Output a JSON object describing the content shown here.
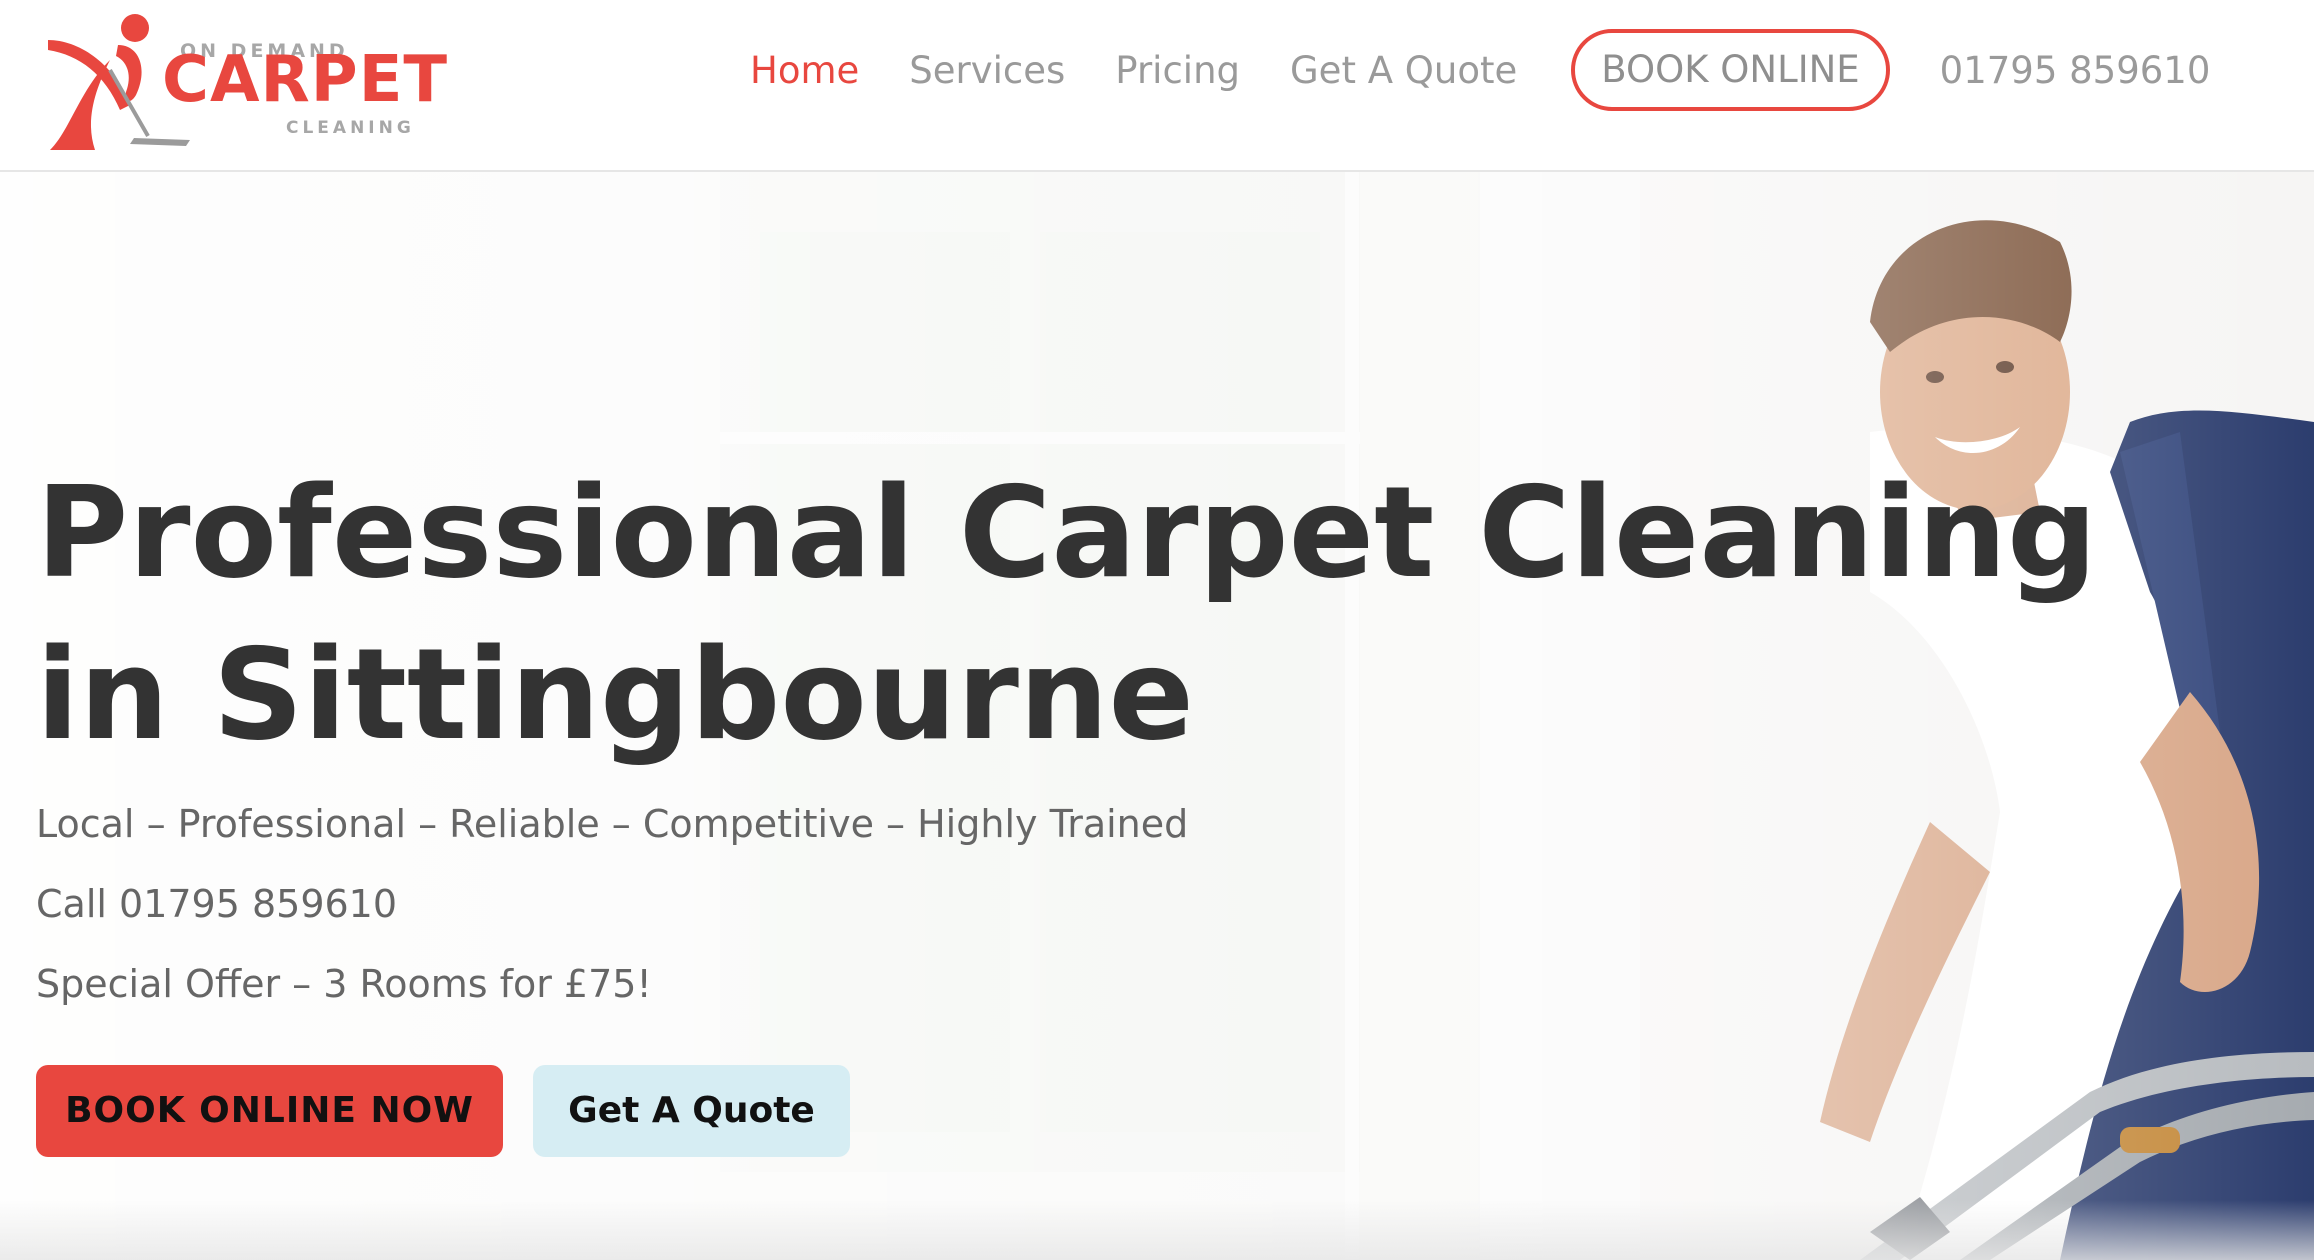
{
  "brand": {
    "top_text": "ON DEMAND",
    "main_text": "CARPET",
    "bottom_text": "CLEANING",
    "accent_color": "#e8473f"
  },
  "nav": {
    "items": [
      {
        "label": "Home",
        "active": true
      },
      {
        "label": "Services",
        "active": false
      },
      {
        "label": "Pricing",
        "active": false
      },
      {
        "label": "Get A Quote",
        "active": false
      }
    ],
    "book_label": "BOOK ONLINE",
    "phone": "01795 859610"
  },
  "hero": {
    "title": "Professional Carpet Cleaning in Sittingbourne",
    "lines": [
      "Local – Professional – Reliable – Competitive – Highly Trained",
      "Call 01795 859610",
      "Special Offer – 3 Rooms for £75!"
    ],
    "primary_button": "BOOK ONLINE NOW",
    "secondary_button": "Get A Quote",
    "primary_color": "#e8473f",
    "secondary_color": "#d6edf3"
  }
}
